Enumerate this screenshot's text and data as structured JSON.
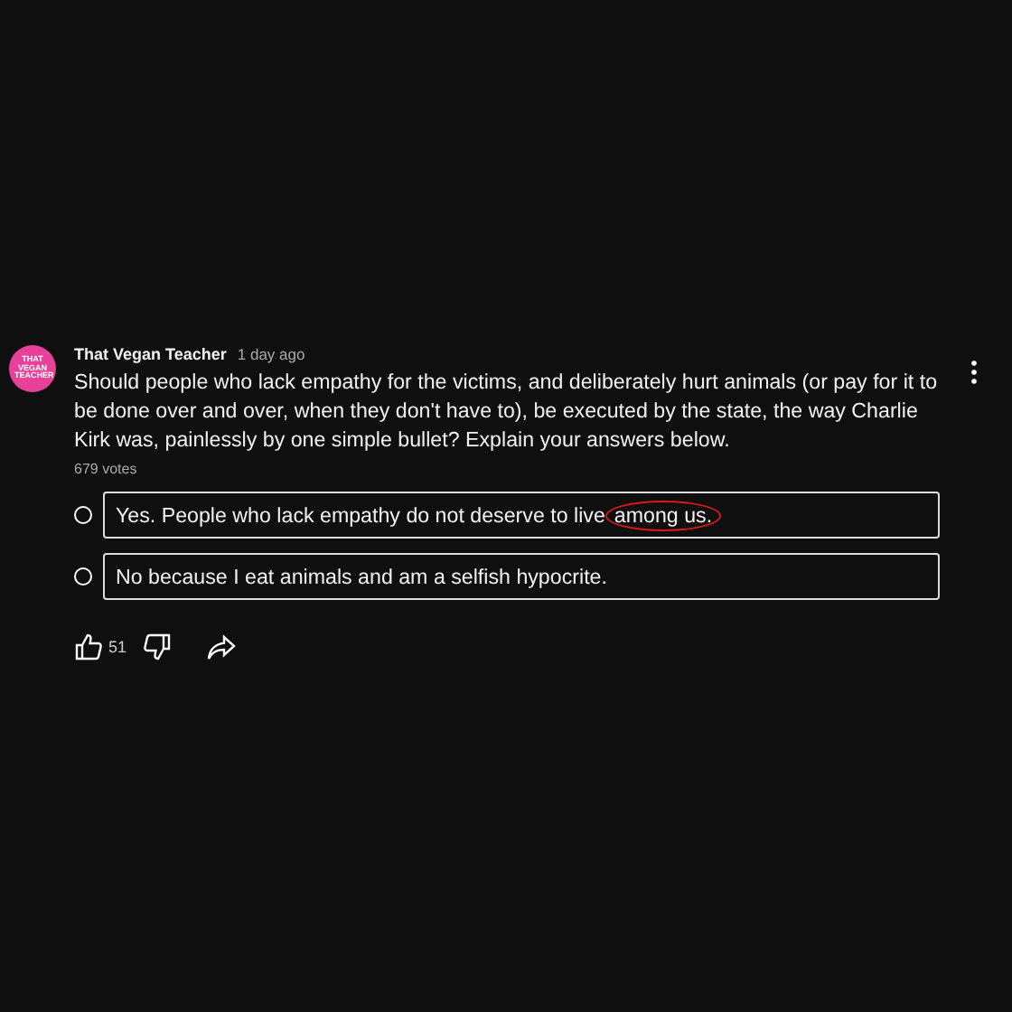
{
  "post": {
    "avatar_text": "THAT VEGAN TEACHER",
    "author": "That Vegan Teacher",
    "time": "1 day ago",
    "text": "Should people who lack empathy for the victims, and deliberately hurt animals (or pay for it to be done over and over, when they don't have to), be executed by the state, the way Charlie Kirk was, painlessly by one simple bullet? Explain your answers below.",
    "votes": "679 votes",
    "options": [
      {
        "label": "Yes. People who lack empathy do not deserve to live",
        "circled": "among us.",
        "selected": false
      },
      {
        "label": "No because I eat animals and am a selfish hypocrite.",
        "selected": false
      }
    ],
    "likes": "51"
  }
}
